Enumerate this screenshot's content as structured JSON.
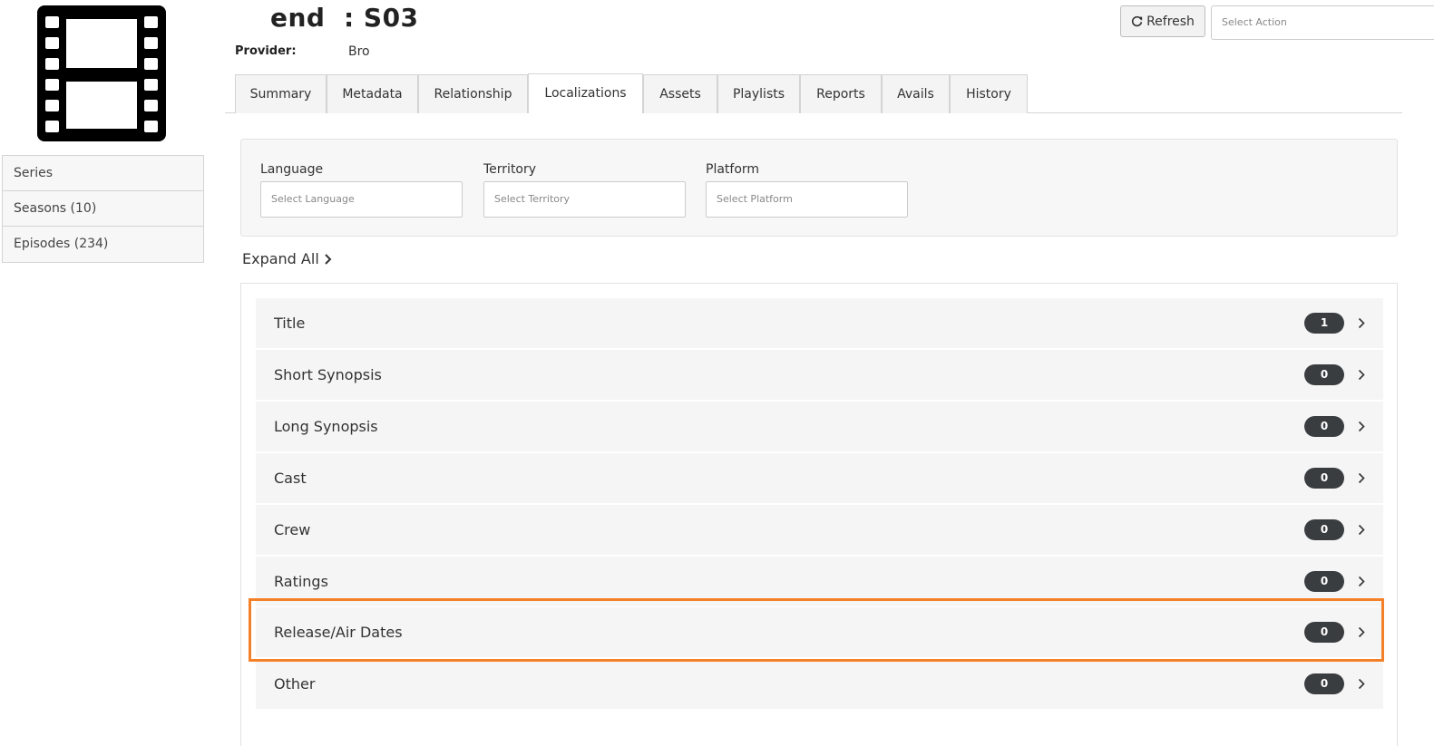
{
  "header": {
    "title": "end  : S03",
    "provider_label": "Provider:",
    "provider_value": "Bro",
    "refresh_label": "Refresh",
    "action_placeholder": "Select Action"
  },
  "sidebar": {
    "items": [
      {
        "label": "Series"
      },
      {
        "label": "Seasons (10)"
      },
      {
        "label": "Episodes (234)"
      }
    ]
  },
  "tabs": [
    {
      "label": "Summary"
    },
    {
      "label": "Metadata"
    },
    {
      "label": "Relationship"
    },
    {
      "label": "Localizations",
      "active": true
    },
    {
      "label": "Assets"
    },
    {
      "label": "Playlists"
    },
    {
      "label": "Reports"
    },
    {
      "label": "Avails"
    },
    {
      "label": "History"
    }
  ],
  "filters": {
    "language": {
      "label": "Language",
      "placeholder": "Select Language"
    },
    "territory": {
      "label": "Territory",
      "placeholder": "Select Territory"
    },
    "platform": {
      "label": "Platform",
      "placeholder": "Select Platform"
    }
  },
  "expand_all": "Expand All",
  "sections": [
    {
      "label": "Title",
      "count": "1"
    },
    {
      "label": "Short Synopsis",
      "count": "0"
    },
    {
      "label": "Long Synopsis",
      "count": "0"
    },
    {
      "label": "Cast",
      "count": "0"
    },
    {
      "label": "Crew",
      "count": "0"
    },
    {
      "label": "Ratings",
      "count": "0"
    },
    {
      "label": "Release/Air Dates",
      "count": "0",
      "highlighted": true
    },
    {
      "label": "Other",
      "count": "0"
    }
  ],
  "colors": {
    "highlight": "#f5802a",
    "badge": "#3a3d40"
  },
  "icons": {
    "logo": "film-strip-icon",
    "refresh": "refresh-icon",
    "expand": "chevron-right-icon"
  }
}
